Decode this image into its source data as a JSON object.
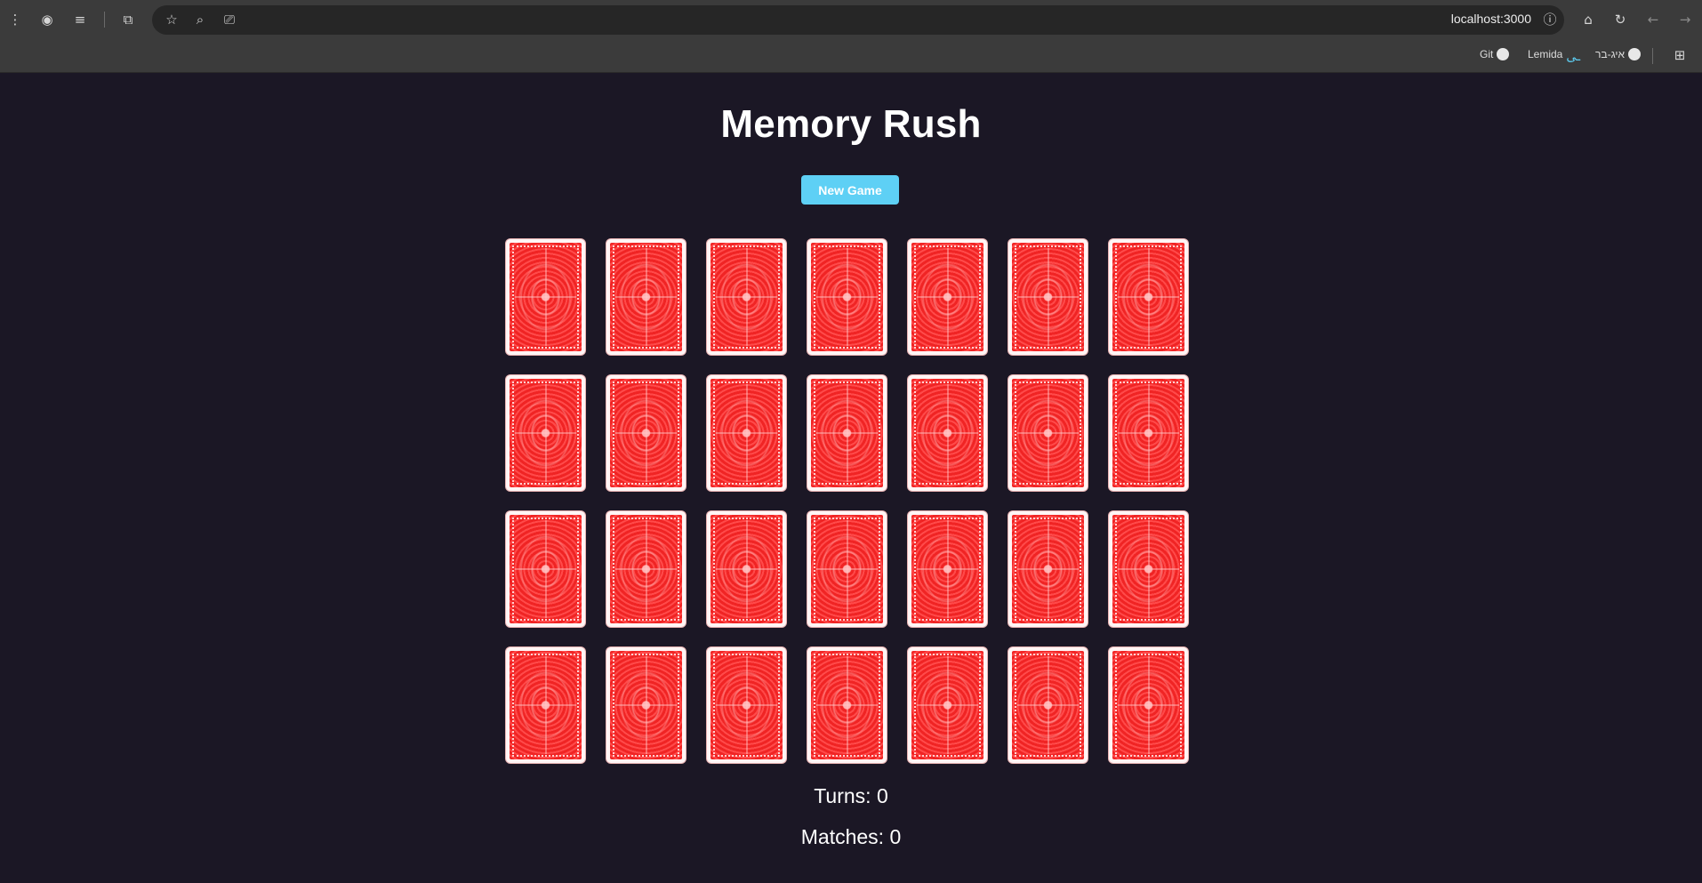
{
  "browser": {
    "url": "localhost:3000",
    "bookmarks": [
      {
        "label": "Git",
        "icon": "github-icon"
      },
      {
        "label": "Lemida",
        "icon": "lemida-icon"
      },
      {
        "label": "איג-בר",
        "icon": "globe-icon"
      }
    ],
    "icons": [
      "menu-dots-icon",
      "profile-icon",
      "reading-list-icon",
      "extensions-icon",
      "star-icon",
      "zoom-icon",
      "cast-icon",
      "info-icon",
      "home-icon",
      "reload-icon",
      "back-icon",
      "forward-icon",
      "apps-icon"
    ]
  },
  "game": {
    "title": "Memory Rush",
    "new_game_label": "New Game",
    "turns_text": "Turns: 0",
    "matches_text": "Matches: 0",
    "grid": {
      "rows": 4,
      "columns": 7,
      "card_count": 28,
      "face_down": true
    },
    "colors": {
      "background": "#1b1725",
      "button": "#5ed0f5",
      "card_back": "#ee2020"
    }
  }
}
